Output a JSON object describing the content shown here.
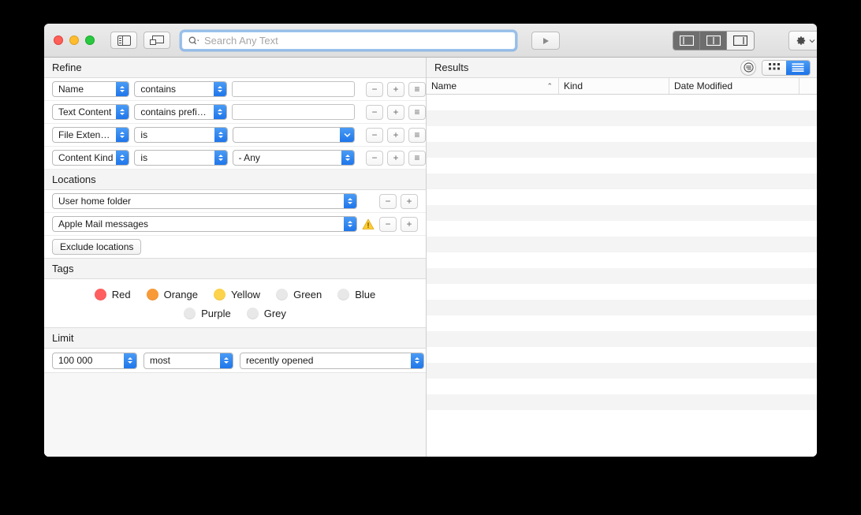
{
  "window": {
    "traffic_lights": [
      "close",
      "minimize",
      "zoom"
    ]
  },
  "toolbar": {
    "sidebar_button": "sidebar-toggle",
    "preview_button": "preview-toggle",
    "search": {
      "placeholder": "Search Any Text",
      "value": "",
      "icon": "search-icon"
    },
    "play_button_label": "▶",
    "layout_segments": [
      {
        "name": "layout-left",
        "active": false
      },
      {
        "name": "layout-split",
        "active": false
      },
      {
        "name": "layout-right",
        "active": true
      }
    ],
    "gear_button": "gear-icon",
    "share_button": "share-icon"
  },
  "refine": {
    "header": "Refine",
    "rows": [
      {
        "attribute": "Name",
        "operator": "contains",
        "value": "",
        "value_control": "textfield",
        "remove_label": "−",
        "add_label": "+",
        "menu_label": "≡"
      },
      {
        "attribute": "Text Content",
        "operator": "contains prefixes",
        "value": "",
        "value_control": "textfield",
        "remove_label": "−",
        "add_label": "+",
        "menu_label": "≡"
      },
      {
        "attribute": "File Extension",
        "operator": "is",
        "value": "",
        "value_control": "combo",
        "remove_label": "−",
        "add_label": "+",
        "menu_label": "≡"
      },
      {
        "attribute": "Content Kind",
        "operator": "is",
        "value": "- Any",
        "value_control": "popup",
        "remove_label": "−",
        "add_label": "+",
        "menu_label": "≡"
      }
    ]
  },
  "locations": {
    "header": "Locations",
    "rows": [
      {
        "value": "User home folder",
        "warning": false,
        "remove_label": "−",
        "add_label": "+"
      },
      {
        "value": "Apple Mail messages",
        "warning": true,
        "remove_label": "−",
        "add_label": "+"
      }
    ],
    "exclude_button": "Exclude locations"
  },
  "tags": {
    "header": "Tags",
    "row1": [
      {
        "label": "Red",
        "color": "#ff5f5f",
        "selected": true
      },
      {
        "label": "Orange",
        "color": "#f89a38",
        "selected": true
      },
      {
        "label": "Yellow",
        "color": "#fcd34a",
        "selected": true
      },
      {
        "label": "Green",
        "color": "#e8e8e8",
        "selected": false
      },
      {
        "label": "Blue",
        "color": "#e8e8e8",
        "selected": false
      }
    ],
    "row2": [
      {
        "label": "Purple",
        "color": "#e8e8e8",
        "selected": false
      },
      {
        "label": "Grey",
        "color": "#e8e8e8",
        "selected": false
      }
    ]
  },
  "limit": {
    "header": "Limit",
    "count": "100 000",
    "qualifier": "most",
    "criterion": "recently opened"
  },
  "results": {
    "header": "Results",
    "filter_icon": "filter-icon",
    "view_modes": [
      {
        "name": "grid-view",
        "active": false
      },
      {
        "name": "list-view",
        "active": true
      }
    ],
    "columns": [
      {
        "label": "Name",
        "sorted": true,
        "sort_caret": "⌃"
      },
      {
        "label": "Kind",
        "sorted": false
      },
      {
        "label": "Date Modified",
        "sorted": false
      }
    ],
    "row_count": 21
  }
}
